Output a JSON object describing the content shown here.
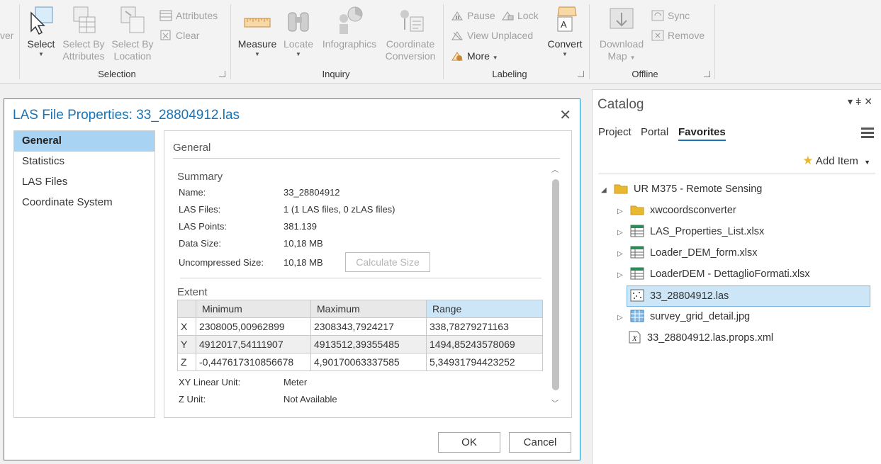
{
  "ribbon": {
    "cut_left_text": "ver",
    "selection": {
      "select": "Select",
      "select_by_attributes": [
        "Select By",
        "Attributes"
      ],
      "select_by_location": [
        "Select By",
        "Location"
      ],
      "attributes": "Attributes",
      "clear": "Clear",
      "group_label": "Selection"
    },
    "inquiry": {
      "measure": "Measure",
      "locate": "Locate",
      "infographics": "Infographics",
      "coordinate_conversion": [
        "Coordinate",
        "Conversion"
      ],
      "group_label": "Inquiry"
    },
    "labeling": {
      "pause": "Pause",
      "lock": "Lock",
      "view_unplaced": "View Unplaced",
      "more": "More",
      "convert": "Convert",
      "group_label": "Labeling"
    },
    "offline": {
      "download_map": [
        "Download",
        "Map"
      ],
      "sync": "Sync",
      "remove": "Remove",
      "group_label": "Offline"
    }
  },
  "dialog": {
    "title": "LAS File Properties: 33_28804912.las",
    "nav": [
      "General",
      "Statistics",
      "LAS Files",
      "Coordinate System"
    ],
    "section_title": "General",
    "summary": {
      "heading": "Summary",
      "rows": [
        {
          "label": "Name:",
          "value": "33_28804912"
        },
        {
          "label": "LAS Files:",
          "value": "1 (1 LAS files, 0 zLAS files)"
        },
        {
          "label": "LAS Points:",
          "value": "381.139"
        },
        {
          "label": "Data Size:",
          "value": "10,18 MB"
        },
        {
          "label": "Uncompressed Size:",
          "value": "10,18 MB"
        }
      ],
      "calculate_button": "Calculate Size"
    },
    "extent": {
      "heading": "Extent",
      "columns": [
        "",
        "Minimum",
        "Maximum",
        "Range"
      ],
      "rows": [
        [
          "X",
          "2308005,00962899",
          "2308343,7924217",
          "338,78279271163"
        ],
        [
          "Y",
          "4912017,54111907",
          "4913512,39355485",
          "1494,85243578069"
        ],
        [
          "Z",
          "-0,447617310856678",
          "4,90170063337585",
          "5,34931794423252"
        ]
      ]
    },
    "units": [
      {
        "label": "XY Linear Unit:",
        "value": "Meter"
      },
      {
        "label": "Z Unit:",
        "value": "Not Available"
      }
    ],
    "ok": "OK",
    "cancel": "Cancel"
  },
  "catalog": {
    "title": "Catalog",
    "tabs": [
      "Project",
      "Portal",
      "Favorites"
    ],
    "add_item": "Add Item",
    "tree": {
      "root": "UR M375 - Remote Sensing",
      "items": [
        {
          "name": "xwcoordsconverter",
          "icon": "folder-icon"
        },
        {
          "name": "LAS_Properties_List.xlsx",
          "icon": "excel-file-icon"
        },
        {
          "name": "Loader_DEM_form.xlsx",
          "icon": "excel-file-icon"
        },
        {
          "name": "LoaderDEM - DettaglioFormati.xlsx",
          "icon": "excel-file-icon"
        },
        {
          "name": "33_28804912.las",
          "icon": "las-file-icon"
        },
        {
          "name": "survey_grid_detail.jpg",
          "icon": "image-file-icon"
        },
        {
          "name": "33_28804912.las.props.xml",
          "icon": "xml-file-icon"
        }
      ]
    }
  },
  "colors": {
    "accent": "#1a73b5",
    "selection": "#cde6f7",
    "nav_active": "#a9d3f2",
    "folder": "#e8b830"
  }
}
